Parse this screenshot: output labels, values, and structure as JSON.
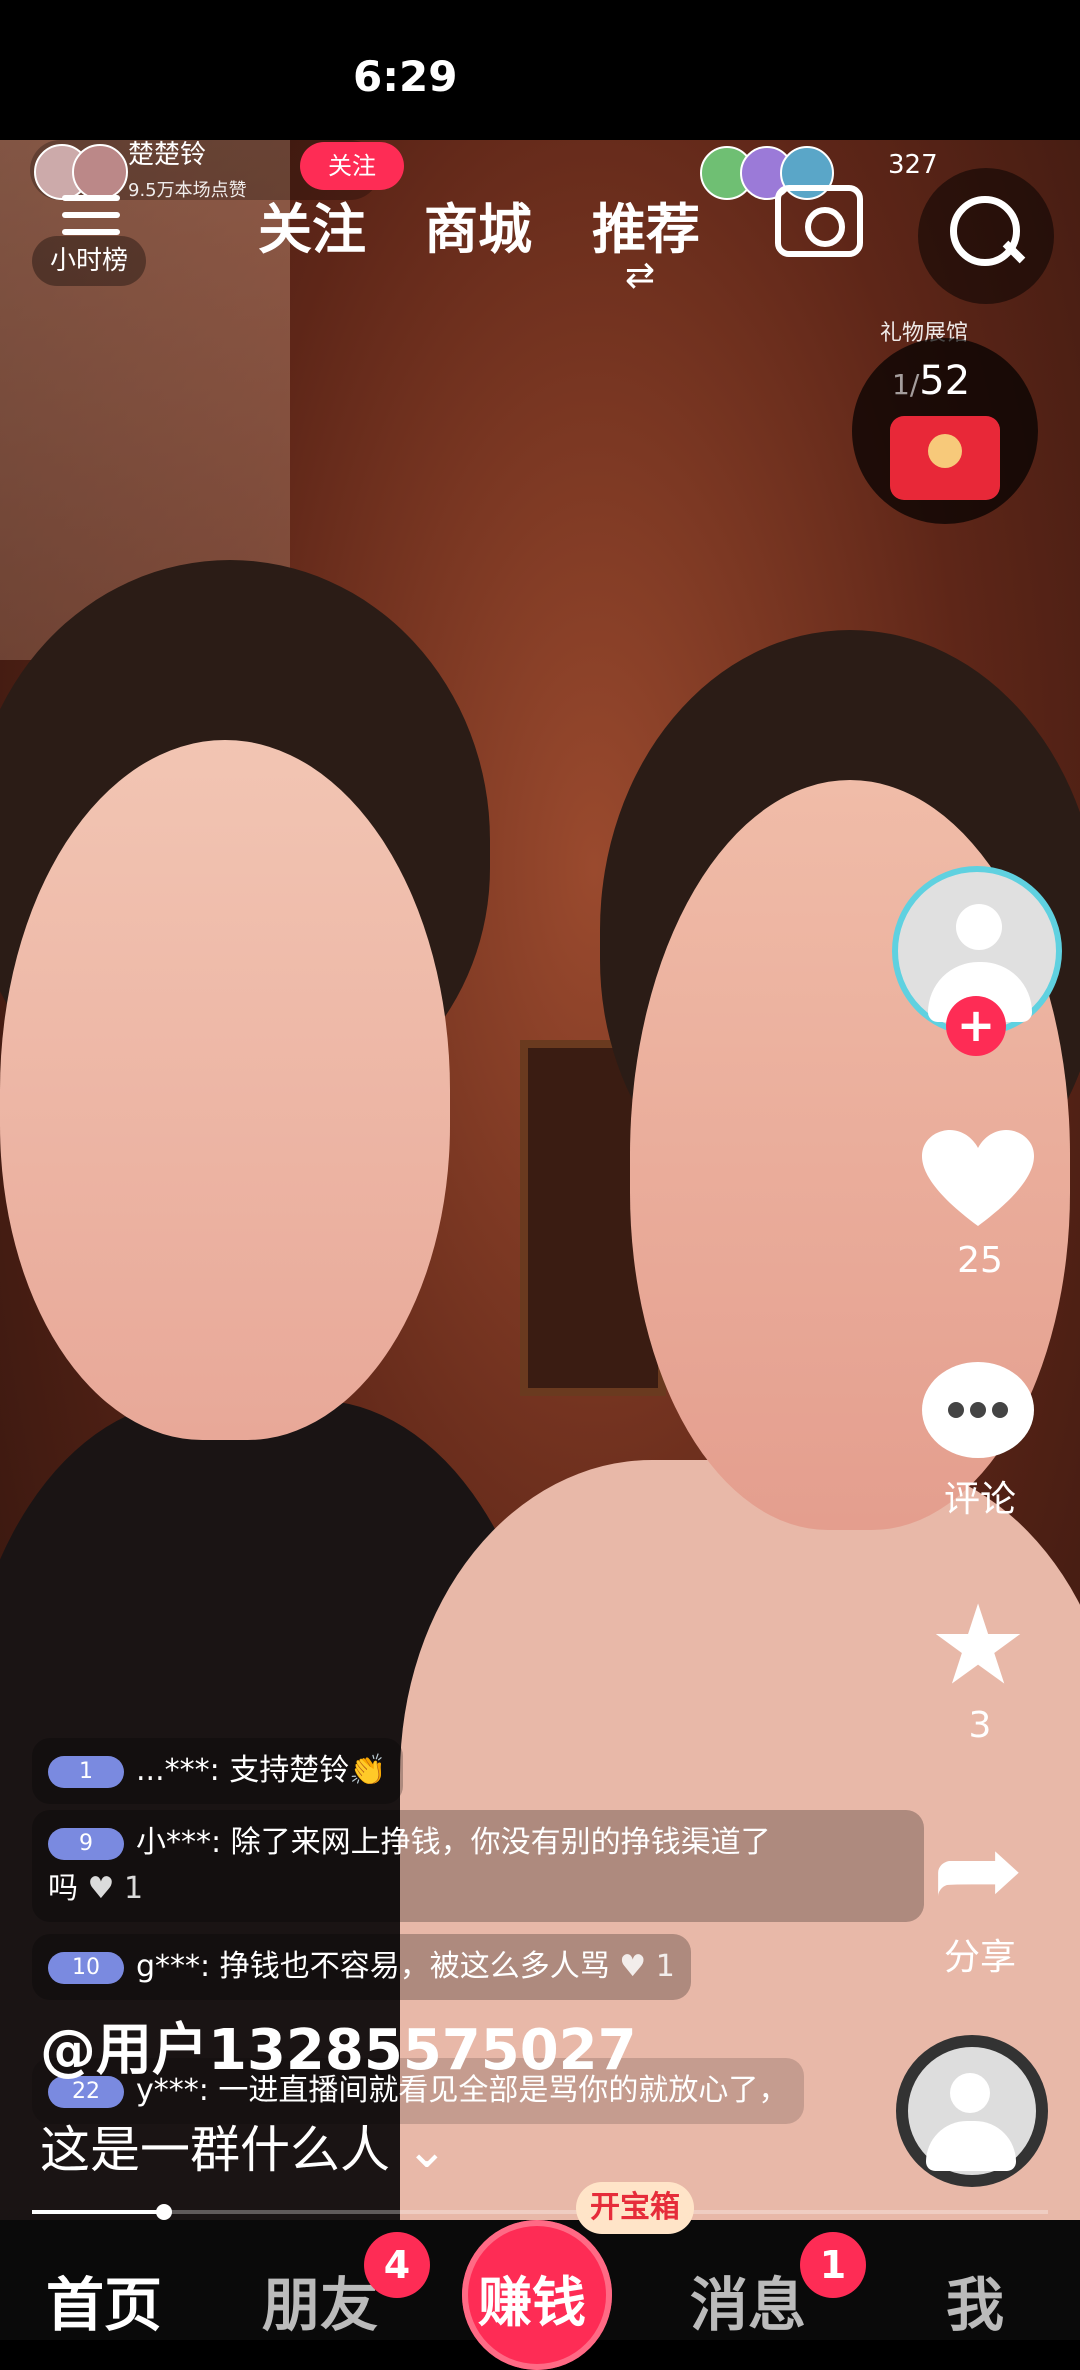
{
  "status_bar": {
    "time": "6:29"
  },
  "stream": {
    "host_name": "楚楚铃",
    "host_likes": "9.5万本场点赞",
    "follow_label": "关注",
    "rank_label": "小时榜",
    "viewer_count": "327",
    "gift_label": "礼物展馆",
    "redpacket_count": "52",
    "redpacket_prefix": "1/"
  },
  "top_nav": {
    "tabs": [
      {
        "label": "关注"
      },
      {
        "label": "商城"
      },
      {
        "label": "推荐"
      }
    ],
    "active_tab": "推荐"
  },
  "right_rail": {
    "like_count": "25",
    "comment_label": "评论",
    "favorite_count": "3",
    "share_label": "分享"
  },
  "comments": [
    {
      "level": "1",
      "user": "...***:",
      "text": "支持楚铃👏"
    },
    {
      "level": "9",
      "user": "小***:",
      "text": "除了来网上挣钱，你没有别的挣钱渠道了",
      "text2": "吗",
      "likes": "1"
    },
    {
      "level": "10",
      "user": "g***:",
      "text": "挣钱也不容易，被这么多人骂",
      "likes": "1"
    },
    {
      "level": "22",
      "user": "y***:",
      "text": "一进直播间就看见全部是骂你的就放心了，"
    }
  ],
  "post": {
    "handle": "@用户13285575027",
    "description": "这是一群什么人",
    "progress": 0.13
  },
  "bottom_nav": {
    "home": "首页",
    "friends": "朋友",
    "friends_badge": "4",
    "earn": "赚钱",
    "treasure": "开宝箱",
    "messages": "消息",
    "messages_badge": "1",
    "me": "我"
  },
  "colors": {
    "accent": "#fe2c55",
    "level": "#7a8ae0"
  }
}
